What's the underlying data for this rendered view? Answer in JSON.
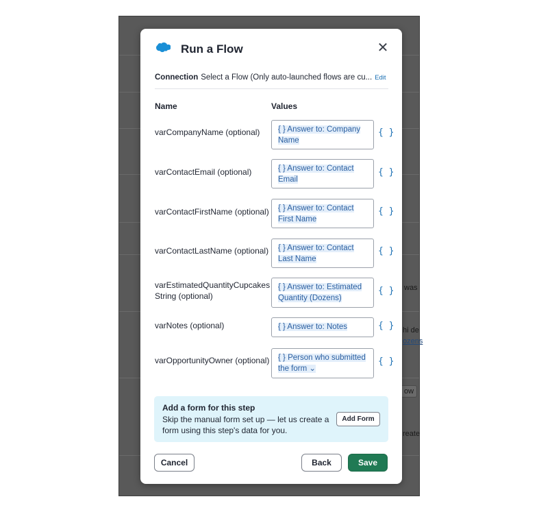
{
  "background": {
    "fragments": [
      "was",
      "hi de",
      "ozens",
      "ow",
      "reate"
    ]
  },
  "modal": {
    "title": "Run a Flow",
    "icon": "salesforce-cloud-icon",
    "close_icon": "close-icon",
    "connection": {
      "label": "Connection",
      "value": "Select a Flow (Only auto-launched flows are cu...",
      "edit": "Edit"
    },
    "columns": {
      "name": "Name",
      "values": "Values"
    },
    "params": [
      {
        "name": "varCompanyName (optional)",
        "value": "{ } Answer to: Company Name"
      },
      {
        "name": "varContactEmail (optional)",
        "value": "{ } Answer to: Contact Email"
      },
      {
        "name": "varContactFirstName (optional)",
        "value": "{ } Answer to: Contact First Name"
      },
      {
        "name": "varContactLastName (optional)",
        "value": "{ } Answer to: Contact Last Name"
      },
      {
        "name": "varEstimatedQuantityCupcakesString (optional)",
        "value": "{ } Answer to: Estimated Quantity (Dozens)"
      },
      {
        "name": "varNotes (optional)",
        "value": "{ } Answer to: Notes"
      },
      {
        "name": "varOpportunityOwner (optional)",
        "value": "{ } Person who submitted the form ⌄"
      }
    ],
    "variable_picker_label": "{ }",
    "callout": {
      "title": "Add a form for this step",
      "description": "Skip the manual form set up — let us create a form using this step's data for you.",
      "button": "Add Form"
    },
    "footer": {
      "cancel": "Cancel",
      "back": "Back",
      "save": "Save"
    }
  },
  "colors": {
    "primary": "#207a54",
    "link": "#1a6fb3",
    "callout_bg": "#dff4fb",
    "token_bg": "#e3eefa"
  }
}
